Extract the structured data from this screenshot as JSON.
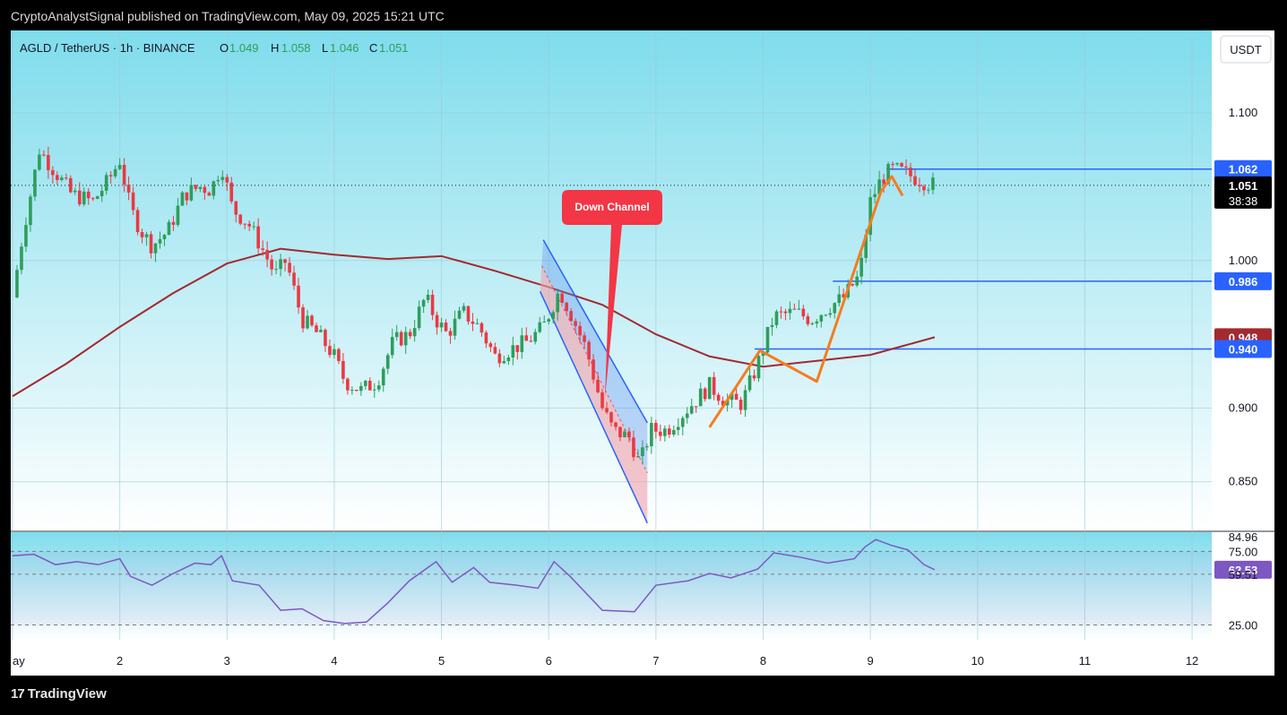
{
  "publish_line": "CryptoAnalystSignal published on TradingView.com, May 09, 2025 15:21 UTC",
  "symbol_bar": {
    "symbol": "AGLD / TetherUS · 1h · BINANCE",
    "o_label": "O",
    "o_value": "1.049",
    "h_label": "H",
    "h_value": "1.058",
    "l_label": "L",
    "l_value": "1.046",
    "c_label": "C",
    "c_value": "1.051"
  },
  "currency_button": "USDT",
  "countdown": "38:38",
  "annotation": {
    "callout_text": "Down Channel"
  },
  "footer_brand": "TradingView",
  "footer_mark": "17",
  "colors": {
    "background_top": "#7fdcec",
    "background_bottom": "#ffffff",
    "up_candle": "#2e9e5b",
    "down_candle": "#ea3943",
    "ma_line": "#a3292e",
    "level_line": "#2962ff",
    "rsi_line": "#7e57c2",
    "orange_pattern": "#f57c1f",
    "channel_blue": "#5e8ef0",
    "channel_red": "#f2a0aa",
    "callout": "#f23645"
  },
  "chart_data": [
    {
      "type": "candlestick",
      "title": "AGLD / TetherUS · 1h · BINANCE",
      "x_axis": {
        "ticks": [
          "ay",
          "2",
          "3",
          "4",
          "5",
          "6",
          "7",
          "8",
          "9",
          "10",
          "11",
          "12"
        ],
        "range_days": [
          1.0,
          12.2
        ]
      },
      "y_axis": {
        "ticks": [
          "1.100",
          "1.000",
          "0.900",
          "0.850"
        ],
        "ylim": [
          0.817,
          1.156
        ]
      },
      "price_labels": [
        {
          "text": "1.062",
          "value": 1.062,
          "color": "#2962ff"
        },
        {
          "text": "1.051",
          "value": 1.051,
          "color": "#000000"
        },
        {
          "text": "0.986",
          "value": 0.986,
          "color": "#2962ff"
        },
        {
          "text": "0.948",
          "value": 0.948,
          "color": "#a3292e"
        },
        {
          "text": "0.940",
          "value": 0.94,
          "color": "#2962ff"
        }
      ],
      "horizontal_levels": [
        {
          "value": 1.062,
          "from_day": 9.15,
          "to_day": 12.2
        },
        {
          "value": 0.986,
          "from_day": 8.65,
          "to_day": 12.2
        },
        {
          "value": 0.94,
          "from_day": 7.92,
          "to_day": 12.2
        }
      ],
      "last_price_dotted": 1.051,
      "close_path": [
        {
          "x": 1.0,
          "y": 0.975
        },
        {
          "x": 1.1,
          "y": 1.02
        },
        {
          "x": 1.25,
          "y": 1.075
        },
        {
          "x": 1.4,
          "y": 1.06
        },
        {
          "x": 1.55,
          "y": 1.045
        },
        {
          "x": 1.75,
          "y": 1.04
        },
        {
          "x": 1.9,
          "y": 1.055
        },
        {
          "x": 2.0,
          "y": 1.068
        },
        {
          "x": 2.1,
          "y": 1.035
        },
        {
          "x": 2.2,
          "y": 1.02
        },
        {
          "x": 2.3,
          "y": 1.01
        },
        {
          "x": 2.45,
          "y": 1.02
        },
        {
          "x": 2.6,
          "y": 1.045
        },
        {
          "x": 2.75,
          "y": 1.05
        },
        {
          "x": 2.85,
          "y": 1.048
        },
        {
          "x": 2.95,
          "y": 1.065
        },
        {
          "x": 3.05,
          "y": 1.035
        },
        {
          "x": 3.2,
          "y": 1.025
        },
        {
          "x": 3.35,
          "y": 1.005
        },
        {
          "x": 3.45,
          "y": 0.99
        },
        {
          "x": 3.55,
          "y": 1.0
        },
        {
          "x": 3.7,
          "y": 0.96
        },
        {
          "x": 3.85,
          "y": 0.95
        },
        {
          "x": 4.0,
          "y": 0.935
        },
        {
          "x": 4.1,
          "y": 0.918
        },
        {
          "x": 4.25,
          "y": 0.912
        },
        {
          "x": 4.4,
          "y": 0.918
        },
        {
          "x": 4.55,
          "y": 0.945
        },
        {
          "x": 4.7,
          "y": 0.95
        },
        {
          "x": 4.85,
          "y": 0.975
        },
        {
          "x": 4.95,
          "y": 0.96
        },
        {
          "x": 5.05,
          "y": 0.95
        },
        {
          "x": 5.2,
          "y": 0.965
        },
        {
          "x": 5.35,
          "y": 0.955
        },
        {
          "x": 5.5,
          "y": 0.935
        },
        {
          "x": 5.65,
          "y": 0.94
        },
        {
          "x": 5.8,
          "y": 0.945
        },
        {
          "x": 5.95,
          "y": 0.955
        },
        {
          "x": 6.1,
          "y": 0.98
        },
        {
          "x": 6.2,
          "y": 0.965
        },
        {
          "x": 6.35,
          "y": 0.94
        },
        {
          "x": 6.5,
          "y": 0.9
        },
        {
          "x": 6.6,
          "y": 0.885
        },
        {
          "x": 6.75,
          "y": 0.88
        },
        {
          "x": 6.85,
          "y": 0.862
        },
        {
          "x": 6.95,
          "y": 0.885
        },
        {
          "x": 7.1,
          "y": 0.885
        },
        {
          "x": 7.3,
          "y": 0.9
        },
        {
          "x": 7.5,
          "y": 0.915
        },
        {
          "x": 7.65,
          "y": 0.905
        },
        {
          "x": 7.8,
          "y": 0.903
        },
        {
          "x": 7.95,
          "y": 0.93
        },
        {
          "x": 8.1,
          "y": 0.962
        },
        {
          "x": 8.3,
          "y": 0.965
        },
        {
          "x": 8.45,
          "y": 0.96
        },
        {
          "x": 8.6,
          "y": 0.968
        },
        {
          "x": 8.75,
          "y": 0.975
        },
        {
          "x": 8.9,
          "y": 0.99
        },
        {
          "x": 9.0,
          "y": 1.04
        },
        {
          "x": 9.1,
          "y": 1.055
        },
        {
          "x": 9.2,
          "y": 1.062
        },
        {
          "x": 9.3,
          "y": 1.06
        },
        {
          "x": 9.45,
          "y": 1.055
        },
        {
          "x": 9.6,
          "y": 1.051
        }
      ],
      "ma_line": [
        {
          "x": 1.0,
          "y": 0.908
        },
        {
          "x": 1.5,
          "y": 0.93
        },
        {
          "x": 2.0,
          "y": 0.955
        },
        {
          "x": 2.5,
          "y": 0.978
        },
        {
          "x": 3.0,
          "y": 0.998
        },
        {
          "x": 3.5,
          "y": 1.008
        },
        {
          "x": 4.0,
          "y": 1.004
        },
        {
          "x": 4.5,
          "y": 1.001
        },
        {
          "x": 5.0,
          "y": 1.003
        },
        {
          "x": 5.5,
          "y": 0.993
        },
        {
          "x": 6.0,
          "y": 0.982
        },
        {
          "x": 6.5,
          "y": 0.97
        },
        {
          "x": 7.0,
          "y": 0.95
        },
        {
          "x": 7.5,
          "y": 0.935
        },
        {
          "x": 8.0,
          "y": 0.928
        },
        {
          "x": 8.5,
          "y": 0.932
        },
        {
          "x": 9.0,
          "y": 0.936
        },
        {
          "x": 9.3,
          "y": 0.942
        },
        {
          "x": 9.6,
          "y": 0.948
        }
      ],
      "orange_pattern": [
        {
          "x": 7.5,
          "y": 0.887
        },
        {
          "x": 7.97,
          "y": 0.939
        },
        {
          "x": 8.5,
          "y": 0.918
        },
        {
          "x": 9.1,
          "y": 1.047
        },
        {
          "x": 9.2,
          "y": 1.057
        },
        {
          "x": 9.3,
          "y": 1.044
        }
      ],
      "down_channel": {
        "upper_start": {
          "x": 5.95,
          "y": 1.014
        },
        "upper_end": {
          "x": 6.92,
          "y": 0.89
        },
        "lower_start": {
          "x": 5.92,
          "y": 0.979
        },
        "lower_end": {
          "x": 6.92,
          "y": 0.822
        },
        "label": "Down Channel"
      }
    },
    {
      "type": "line",
      "title": "",
      "y_ticks": [
        "84.96",
        "75.00",
        "62.53",
        "59.51",
        "25.00"
      ],
      "levels": [
        75.0,
        59.51,
        25.0
      ],
      "current_value": 62.53,
      "ylim": [
        15,
        88
      ],
      "values": [
        {
          "x": 1.0,
          "y": 72
        },
        {
          "x": 1.2,
          "y": 73
        },
        {
          "x": 1.4,
          "y": 66
        },
        {
          "x": 1.6,
          "y": 68
        },
        {
          "x": 1.8,
          "y": 66
        },
        {
          "x": 2.0,
          "y": 70
        },
        {
          "x": 2.1,
          "y": 58
        },
        {
          "x": 2.3,
          "y": 52
        },
        {
          "x": 2.5,
          "y": 60
        },
        {
          "x": 2.7,
          "y": 67
        },
        {
          "x": 2.85,
          "y": 66
        },
        {
          "x": 2.95,
          "y": 72
        },
        {
          "x": 3.05,
          "y": 55
        },
        {
          "x": 3.3,
          "y": 52
        },
        {
          "x": 3.5,
          "y": 35
        },
        {
          "x": 3.7,
          "y": 36
        },
        {
          "x": 3.9,
          "y": 28
        },
        {
          "x": 4.1,
          "y": 26
        },
        {
          "x": 4.3,
          "y": 27
        },
        {
          "x": 4.5,
          "y": 40
        },
        {
          "x": 4.7,
          "y": 55
        },
        {
          "x": 4.95,
          "y": 68
        },
        {
          "x": 5.1,
          "y": 54
        },
        {
          "x": 5.3,
          "y": 64
        },
        {
          "x": 5.45,
          "y": 54
        },
        {
          "x": 5.7,
          "y": 52
        },
        {
          "x": 5.9,
          "y": 50
        },
        {
          "x": 6.05,
          "y": 68
        },
        {
          "x": 6.2,
          "y": 58
        },
        {
          "x": 6.5,
          "y": 35
        },
        {
          "x": 6.8,
          "y": 34
        },
        {
          "x": 7.0,
          "y": 52
        },
        {
          "x": 7.3,
          "y": 55
        },
        {
          "x": 7.5,
          "y": 60
        },
        {
          "x": 7.7,
          "y": 57
        },
        {
          "x": 7.95,
          "y": 63
        },
        {
          "x": 8.1,
          "y": 74
        },
        {
          "x": 8.35,
          "y": 71
        },
        {
          "x": 8.6,
          "y": 67
        },
        {
          "x": 8.85,
          "y": 70
        },
        {
          "x": 8.95,
          "y": 78
        },
        {
          "x": 9.05,
          "y": 83
        },
        {
          "x": 9.2,
          "y": 79
        },
        {
          "x": 9.35,
          "y": 76
        },
        {
          "x": 9.5,
          "y": 66
        },
        {
          "x": 9.6,
          "y": 62.53
        }
      ]
    }
  ]
}
